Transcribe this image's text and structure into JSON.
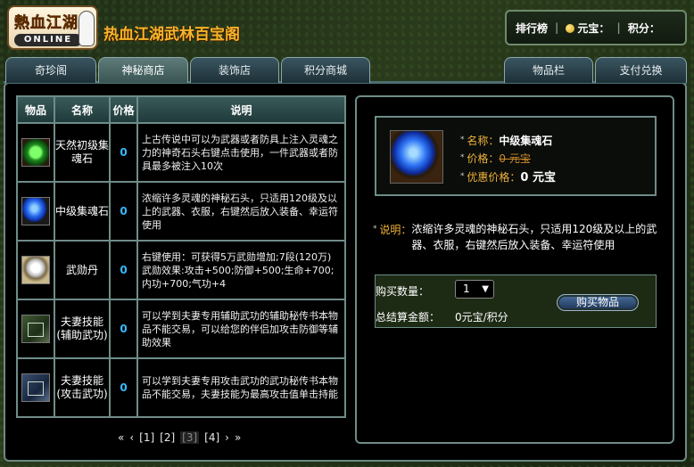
{
  "header": {
    "logo_cn": "熱血江湖",
    "logo_en": "ONLINE",
    "site_title": "热血江湖武林百宝阁",
    "topbar": {
      "ranking_label": "排行榜",
      "yuanbao_label": "元宝：",
      "points_label": "积分："
    }
  },
  "tabs_left": [
    {
      "label": "奇珍阁",
      "active": false
    },
    {
      "label": "神秘商店",
      "active": true
    },
    {
      "label": "装饰店",
      "active": false
    },
    {
      "label": "积分商城",
      "active": false
    }
  ],
  "tabs_right": [
    {
      "label": "物品栏"
    },
    {
      "label": "支付兑换"
    }
  ],
  "table": {
    "headers": [
      "物品",
      "名称",
      "价格",
      "说明"
    ],
    "rows": [
      {
        "icon": "green-soul-stone-icon",
        "name": "天然初级集魂石",
        "price": "0",
        "desc": "上古传说中可以为武器或者防具上注入灵魂之力的神奇石头右键点击使用，一件武器或者防具最多被注入10次"
      },
      {
        "icon": "blue-soul-stone-icon",
        "name": "中级集魂石",
        "price": "0",
        "desc": "浓缩许多灵魂的神秘石头，只适用120级及以上的武器、衣服，右键然后放入装备、幸运符使用"
      },
      {
        "icon": "pill-icon",
        "name": "武勋丹",
        "price": "0",
        "desc": "右键使用：可获得5万武勋增加;7段(120万)武勋效果:攻击+500;防御+500;生命+700;内功+700;气功+4"
      },
      {
        "icon": "skill-book-support-icon",
        "name": "夫妻技能(辅助武功)",
        "price": "0",
        "desc": "可以学到夫妻专用辅助武功的辅助秘传书本物品不能交易，可以给您的伴侣加攻击防御等辅助效果"
      },
      {
        "icon": "skill-book-attack-icon",
        "name": "夫妻技能(攻击武功)",
        "price": "0",
        "desc": "可以学到夫妻专用攻击武功的武功秘传书本物品不能交易，夫妻技能为最高攻击值单击持能"
      }
    ]
  },
  "pager": {
    "first": "«",
    "prev": "‹",
    "pages": [
      "[1]",
      "[2]",
      "[3]",
      "[4]"
    ],
    "current_index": 2,
    "next": "›",
    "last": "»"
  },
  "detail": {
    "name_label": "名称：",
    "name_value": "中级集魂石",
    "price_label": "价格：",
    "price_value": "0 元宝",
    "discount_label": "优惠价格：",
    "discount_value": "0 元宝",
    "desc_label": "说明：",
    "desc_value": "浓缩许多灵魂的神秘石头，只适用120级及以上的武器、衣服，右键然后放入装备、幸运符使用"
  },
  "purchase": {
    "qty_label": "购买数量：",
    "qty_value": "1",
    "total_label": "总结算金额：",
    "total_value": "0元宝/积分",
    "buy_button": "购买物品"
  }
}
